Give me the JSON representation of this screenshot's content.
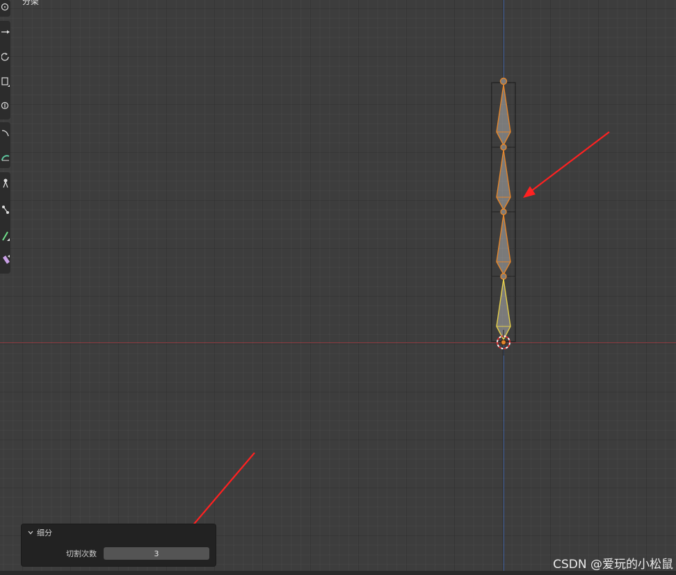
{
  "viewport": {
    "header_label": "分架"
  },
  "toolbar": {
    "tools": [
      {
        "name": "cursor-icon"
      },
      {
        "name": "move-icon"
      },
      {
        "name": "rotate-icon"
      },
      {
        "name": "scale-icon"
      },
      {
        "name": "transform-icon"
      },
      {
        "name": "annotate-icon"
      },
      {
        "name": "measure-icon"
      },
      {
        "name": "roll-icon"
      },
      {
        "name": "bone-size-icon"
      },
      {
        "name": "envelope-icon"
      },
      {
        "name": "extrude-icon"
      }
    ]
  },
  "operator_panel": {
    "title": "细分",
    "field_label": "切割次数",
    "field_value": "3"
  },
  "colors": {
    "axis_x": "#8a3a3f",
    "axis_y": "#3b5a97",
    "bone_selected": "#e5862b",
    "bone_active": "#e6d04a",
    "arrow": "#ff2020"
  },
  "watermark": "CSDN @爱玩的小松鼠"
}
